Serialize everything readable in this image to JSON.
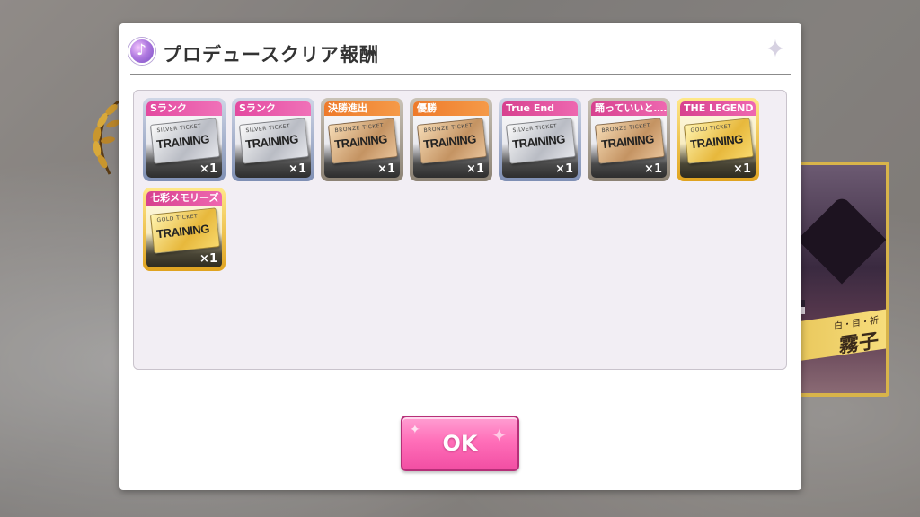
{
  "modal": {
    "title": "プロデュースクリア報酬",
    "ok_label": "OK"
  },
  "rewards": [
    {
      "tag": "Sランク",
      "tag_color": "pink",
      "tier": "silver",
      "ticket_kind": "SILVER TICKET",
      "ticket_word": "TRAINING",
      "quantity": "×1"
    },
    {
      "tag": "Sランク",
      "tag_color": "pink",
      "tier": "silver",
      "ticket_kind": "SILVER TICKET",
      "ticket_word": "TRAINING",
      "quantity": "×1"
    },
    {
      "tag": "決勝進出",
      "tag_color": "orange",
      "tier": "bronze",
      "ticket_kind": "BRONZE TICKET",
      "ticket_word": "TRAINING",
      "quantity": "×1"
    },
    {
      "tag": "優勝",
      "tag_color": "orange",
      "tier": "bronze",
      "ticket_kind": "BRONZE TICKET",
      "ticket_word": "TRAINING",
      "quantity": "×1"
    },
    {
      "tag": "True End",
      "tag_color": "magenta",
      "tier": "silver",
      "ticket_kind": "SILVER TICKET",
      "ticket_word": "TRAINING",
      "quantity": "×1"
    },
    {
      "tag": "踊っていいと……",
      "tag_color": "magenta",
      "tier": "bronze",
      "ticket_kind": "BRONZE TICKET",
      "ticket_word": "TRAINING",
      "quantity": "×1"
    },
    {
      "tag": "THE LEGEND",
      "tag_color": "magenta",
      "tier": "gold",
      "ticket_kind": "GOLD TICKET",
      "ticket_word": "TRAINING",
      "quantity": "×1"
    },
    {
      "tag": "七彩メモリーズ",
      "tag_color": "magenta",
      "tier": "gold",
      "ticket_kind": "GOLD TICKET",
      "ticket_word": "TRAINING",
      "quantity": "×1"
    }
  ],
  "background": {
    "idol_card_subtitle": "白・目・祈",
    "idol_card_name": "霧子"
  },
  "colors": {
    "accent_pink": "#f24fa3",
    "panel_bg": "#f2eef4"
  },
  "icons": {
    "header": "music-note-badge-icon",
    "corner": "sparkle-icon"
  }
}
